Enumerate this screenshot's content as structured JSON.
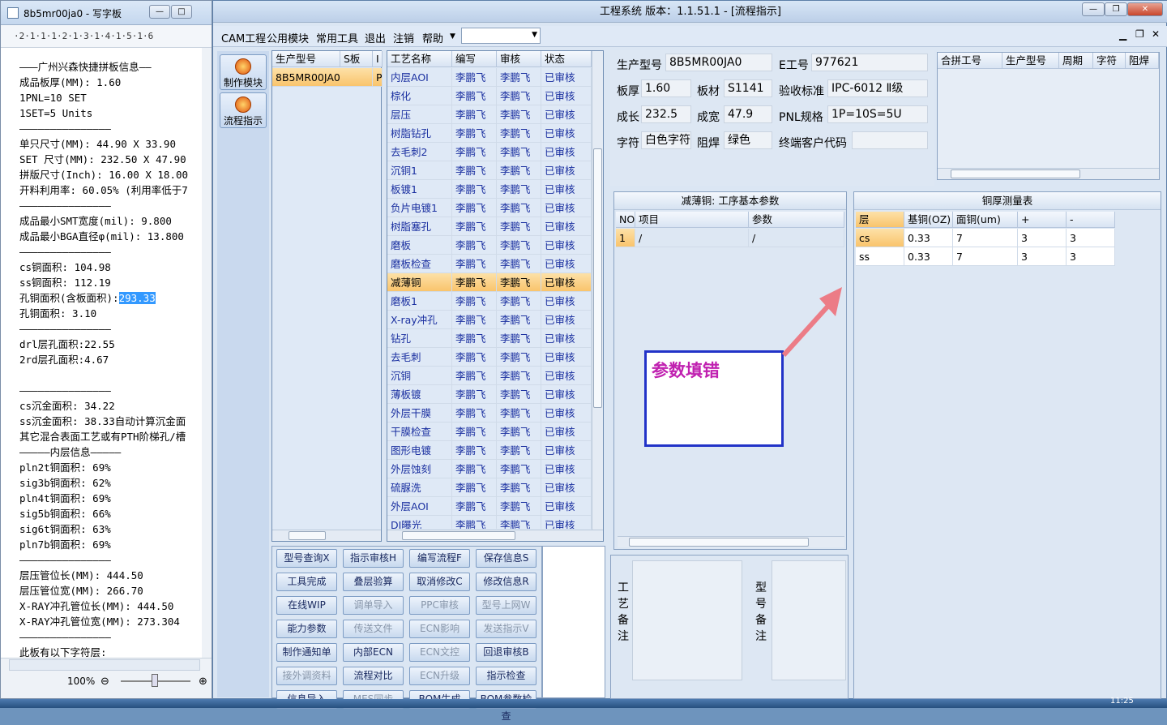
{
  "notepad": {
    "title": "8b5mr00ja0 - 写字板",
    "ruler": "·2·1·1·1·2·1·3·1·4·1·5·1·6",
    "lines": [
      "———广州兴森快捷拼板信息——",
      "成品板厚(MM): 1.60",
      "1PNL=10 SET",
      "1SET=5 Units",
      "———————————————",
      "单只尺寸(MM): 44.90 X 33.90",
      "SET 尺寸(MM): 232.50 X 47.90",
      "拼版尺寸(Inch): 16.00 X 18.00",
      "开料利用率: 60.05% (利用率低于7",
      "———————————————",
      "成品最小SMT宽度(mil): 9.800",
      "成品最小BGA直径φ(mil): 13.800",
      "———————————————",
      "cs铜面积: 104.98",
      "ss铜面积: 112.19",
      "孔铜面积(含板面积):",
      "孔铜面积: 3.10",
      "———————————————",
      "drl层孔面积:22.55",
      "2rd层孔面积:4.67",
      "",
      "———————————————",
      "cs沉金面积: 34.22",
      "ss沉金面积: 38.33自动计算沉金面",
      "其它混合表面工艺或有PTH阶梯孔/槽",
      "—————内层信息—————",
      "pln2t铜面积: 69%",
      "sig3b铜面积: 62%",
      "pln4t铜面积: 69%",
      "sig5b铜面积: 66%",
      "sig6t铜面积: 63%",
      "pln7b铜面积: 69%",
      "———————————————",
      "层压管位长(MM): 444.50",
      "层压管位宽(MM): 266.70",
      "X-RAY冲孔管位长(MM): 444.50",
      "X-RAY冲孔管位宽(MM): 273.304",
      "———————————————",
      "此板有以下字符层:"
    ],
    "highlight": "293.33",
    "zoom": "100%"
  },
  "main": {
    "title": "工程系统   版本：1.1.51.1 - [流程指示]",
    "menu": [
      "CAM工程",
      "公用模块",
      "常用工具",
      "退出",
      "注销",
      "帮助"
    ],
    "tools": [
      "制作模块",
      "流程指示"
    ],
    "model_grid": {
      "headers": [
        "生产型号",
        "S板",
        "I"
      ],
      "rows": [
        [
          "8B5MR00JA0",
          "P"
        ]
      ]
    },
    "process_grid": {
      "headers": [
        "工艺名称",
        "编写",
        "审核",
        "状态"
      ],
      "rows": [
        [
          "内层AOI",
          "李鹏飞",
          "李鹏飞",
          "已审核"
        ],
        [
          "棕化",
          "李鹏飞",
          "李鹏飞",
          "已审核"
        ],
        [
          "层压",
          "李鹏飞",
          "李鹏飞",
          "已审核"
        ],
        [
          "树脂钻孔",
          "李鹏飞",
          "李鹏飞",
          "已审核"
        ],
        [
          "去毛刺2",
          "李鹏飞",
          "李鹏飞",
          "已审核"
        ],
        [
          "沉铜1",
          "李鹏飞",
          "李鹏飞",
          "已审核"
        ],
        [
          "板镀1",
          "李鹏飞",
          "李鹏飞",
          "已审核"
        ],
        [
          "负片电镀1",
          "李鹏飞",
          "李鹏飞",
          "已审核"
        ],
        [
          "树脂塞孔",
          "李鹏飞",
          "李鹏飞",
          "已审核"
        ],
        [
          "磨板",
          "李鹏飞",
          "李鹏飞",
          "已审核"
        ],
        [
          "磨板检查",
          "李鹏飞",
          "李鹏飞",
          "已审核"
        ],
        [
          "减薄铜",
          "李鹏飞",
          "李鹏飞",
          "已审核"
        ],
        [
          "磨板1",
          "李鹏飞",
          "李鹏飞",
          "已审核"
        ],
        [
          "X-ray冲孔",
          "李鹏飞",
          "李鹏飞",
          "已审核"
        ],
        [
          "钻孔",
          "李鹏飞",
          "李鹏飞",
          "已审核"
        ],
        [
          "去毛刺",
          "李鹏飞",
          "李鹏飞",
          "已审核"
        ],
        [
          "沉铜",
          "李鹏飞",
          "李鹏飞",
          "已审核"
        ],
        [
          "薄板镀",
          "李鹏飞",
          "李鹏飞",
          "已审核"
        ],
        [
          "外层干膜",
          "李鹏飞",
          "李鹏飞",
          "已审核"
        ],
        [
          "干膜检查",
          "李鹏飞",
          "李鹏飞",
          "已审核"
        ],
        [
          "图形电镀",
          "李鹏飞",
          "李鹏飞",
          "已审核"
        ],
        [
          "外层蚀刻",
          "李鹏飞",
          "李鹏飞",
          "已审核"
        ],
        [
          "硫脲洗",
          "李鹏飞",
          "李鹏飞",
          "已审核"
        ],
        [
          "外层AOI",
          "李鹏飞",
          "李鹏飞",
          "已审核"
        ],
        [
          "DI曝光",
          "李鹏飞",
          "李鹏飞",
          "已审核"
        ]
      ],
      "selected_index": 11
    },
    "buttons": [
      [
        "型号查询X",
        "指示审核H",
        "编写流程F",
        "保存信息S"
      ],
      [
        "工具完成",
        "叠层验算",
        "取消修改C",
        "修改信息R"
      ],
      [
        "在线WIP",
        "调单导入",
        "PPC审核",
        "型号上网W"
      ],
      [
        "能力参数",
        "传送文件",
        "ECN影响",
        "发送指示V"
      ],
      [
        "制作通知单",
        "内部ECN",
        "ECN文控",
        "回退审核B"
      ],
      [
        "接外调资料",
        "流程对比",
        "ECN升级",
        "指示检查"
      ],
      [
        "信息导入",
        "MES同步",
        "BOM生成",
        "BOM参数检查"
      ]
    ],
    "disabled_buttons": [
      "调单导入",
      "PPC审核",
      "型号上网W",
      "传送文件",
      "ECN影响",
      "发送指示V",
      "ECN文控",
      "接外调资料",
      "ECN升级",
      "MES同步"
    ],
    "info": {
      "model_label": "生产型号",
      "model": "8B5MR00JA0",
      "eno_label": "E工号",
      "eno": "977621",
      "thick_label": "板厚",
      "thick": "1.60",
      "mat_label": "板材",
      "mat": "S1141",
      "std_label": "验收标准",
      "std": "IPC-6012 Ⅱ级",
      "len_label": "成长",
      "len": "232.5",
      "wid_label": "成宽",
      "wid": "47.9",
      "pnl_label": "PNL规格",
      "pnl": "1P=10S=5U",
      "char_label": "字符",
      "char": "白色字符",
      "mask_label": "阻焊",
      "mask": "绿色",
      "cust_label": "终端客户代码",
      "cust": ""
    },
    "merge_grid": {
      "headers": [
        "合拼工号",
        "生产型号",
        "周期",
        "字符",
        "阻焊"
      ]
    },
    "param_panel": {
      "title": "减薄铜: 工序基本参数",
      "headers": [
        "NO",
        "项目",
        "参数"
      ],
      "rows": [
        [
          "1",
          "/",
          "/"
        ]
      ]
    },
    "copper_panel": {
      "title": "铜厚测量表",
      "headers": [
        "层",
        "基铜(OZ)",
        "面铜(um)",
        "+",
        "-"
      ],
      "rows": [
        [
          "cs",
          "0.33",
          "7",
          "3",
          "3"
        ],
        [
          "ss",
          "0.33",
          "7",
          "3",
          "3"
        ]
      ]
    },
    "annotation": "参数填错",
    "process_note_label": "工艺备注",
    "model_note_label": "型号备注"
  },
  "taskbar": {
    "clock": "11:25"
  }
}
